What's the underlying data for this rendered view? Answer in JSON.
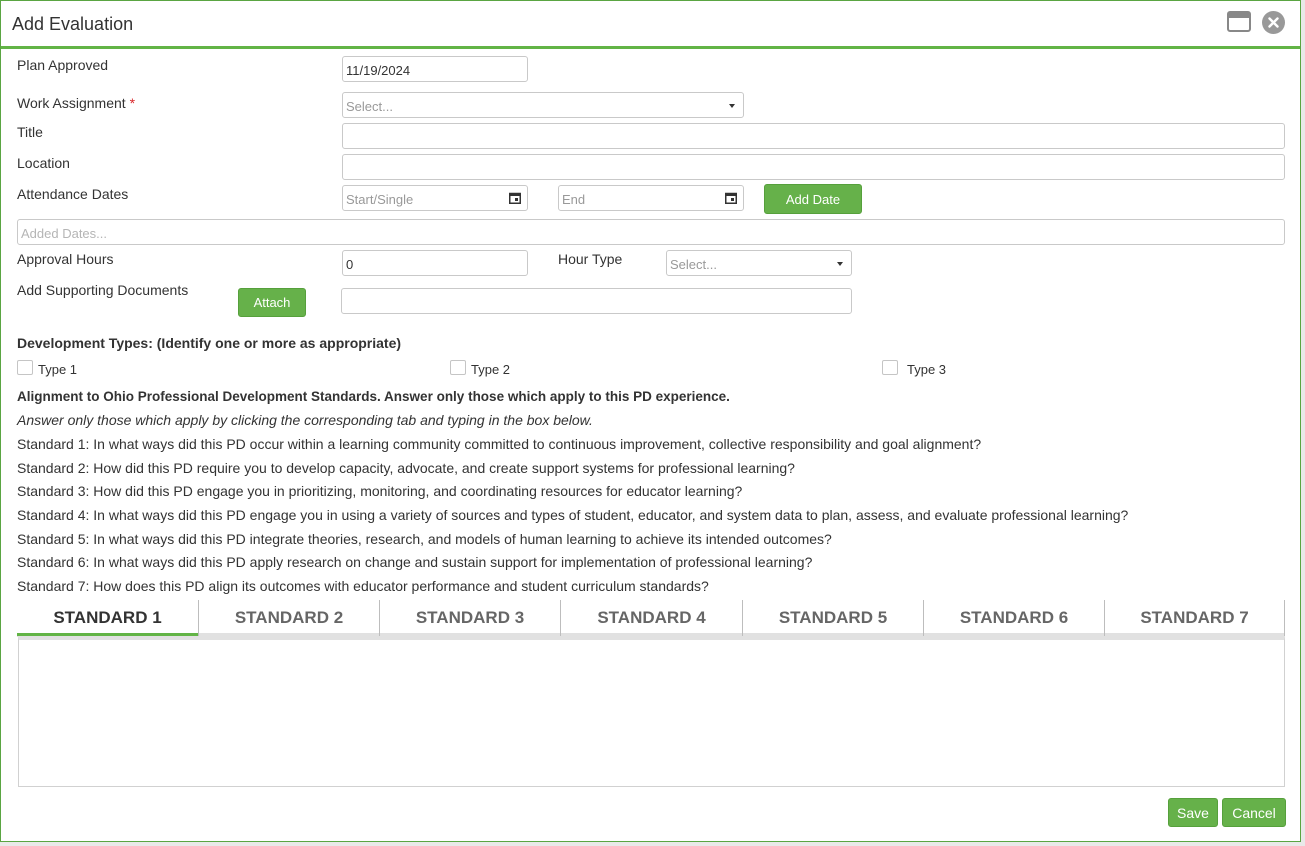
{
  "dialog": {
    "title": "Add Evaluation",
    "maximize_icon": "maximize-icon",
    "close_icon": "close-icon"
  },
  "form": {
    "plan_approved": {
      "label": "Plan Approved",
      "value": "11/19/2024"
    },
    "work_assignment": {
      "label": "Work Assignment",
      "required_mark": "*",
      "placeholder": "Select..."
    },
    "title": {
      "label": "Title",
      "value": ""
    },
    "location": {
      "label": "Location",
      "value": ""
    },
    "attendance_dates": {
      "label": "Attendance Dates",
      "start_placeholder": "Start/Single",
      "end_placeholder": "End",
      "add_date_label": "Add Date"
    },
    "added_dates_placeholder": "Added Dates...",
    "approval_hours": {
      "label": "Approval Hours",
      "value": "0"
    },
    "hour_type": {
      "label": "Hour Type",
      "placeholder": "Select..."
    },
    "supporting_docs": {
      "label": "Add Supporting Documents",
      "attach_label": "Attach",
      "value": ""
    }
  },
  "development_types": {
    "heading": "Development Types: (Identify one or more as appropriate)",
    "items": [
      {
        "label": "Type 1",
        "checked": false
      },
      {
        "label": "Type 2",
        "checked": false
      },
      {
        "label": "Type 3",
        "checked": false
      }
    ]
  },
  "alignment": {
    "heading": "Alignment to Ohio Professional Development Standards. Answer only those which apply to this PD experience.",
    "instruction": "Answer only those which apply by clicking the corresponding tab and typing in the box below.",
    "standards": [
      "Standard 1: In what ways did this PD occur within a learning community committed to continuous improvement, collective responsibility and goal alignment?",
      "Standard 2: How did this PD require you to develop capacity, advocate, and create support systems for professional learning?",
      "Standard 3: How did this PD engage you in prioritizing, monitoring, and coordinating resources for educator learning?",
      "Standard 4: In what ways did this PD engage you in using a variety of sources and types of student, educator, and system data to plan, assess, and evaluate professional learning?",
      "Standard 5: In what ways did this PD integrate theories, research, and models of human learning to achieve its intended outcomes?",
      "Standard 6: In what ways did this PD apply research on change and sustain support for implementation of professional learning?",
      "Standard 7: How does this PD align its outcomes with educator performance and student curriculum standards?"
    ]
  },
  "tabs": [
    "STANDARD 1",
    "STANDARD 2",
    "STANDARD 3",
    "STANDARD 4",
    "STANDARD 5",
    "STANDARD 6",
    "STANDARD 7"
  ],
  "active_tab": "STANDARD 1",
  "answer_text": "",
  "footer": {
    "save_label": "Save",
    "cancel_label": "Cancel"
  },
  "colors": {
    "accent": "#62b446",
    "button": "#66b14a",
    "required": "#d9262a"
  }
}
